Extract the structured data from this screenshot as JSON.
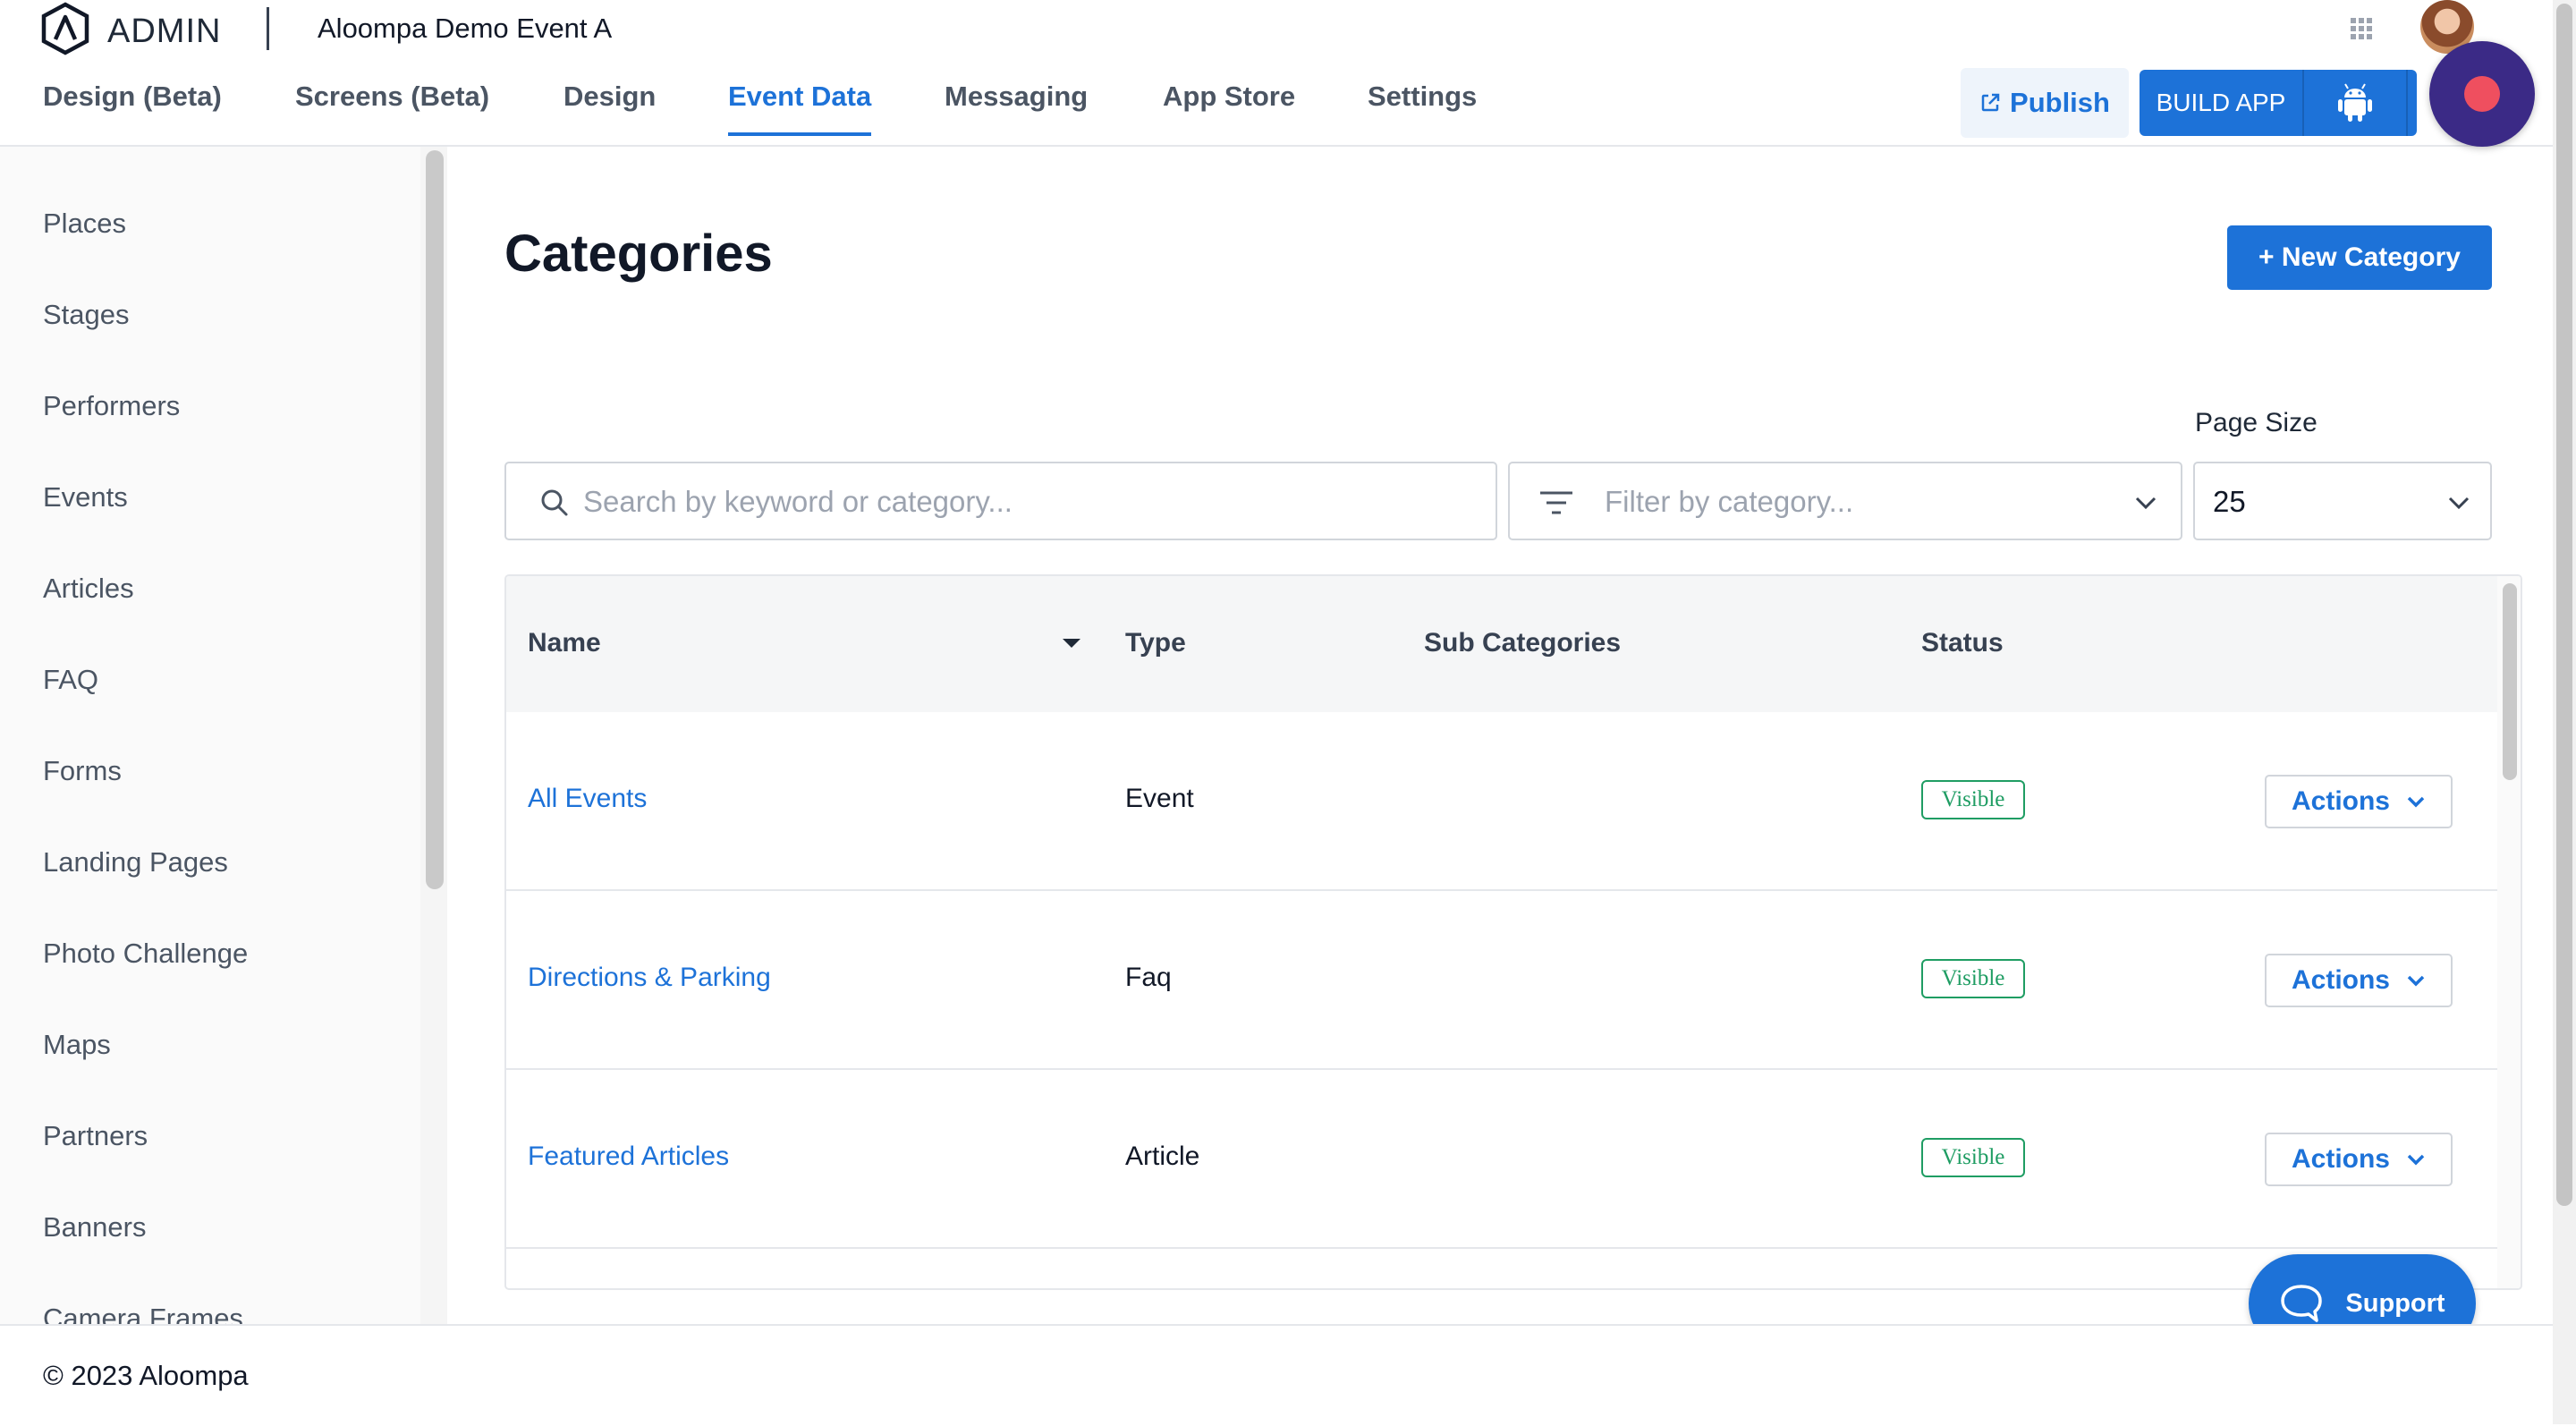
{
  "header": {
    "logo_text": "ADMIN",
    "event_title": "Aloompa Demo Event A"
  },
  "nav": {
    "tabs": [
      {
        "label": "Design (Beta)"
      },
      {
        "label": "Screens (Beta)"
      },
      {
        "label": "Design"
      },
      {
        "label": "Event Data",
        "active": true
      },
      {
        "label": "Messaging"
      },
      {
        "label": "App Store"
      },
      {
        "label": "Settings"
      }
    ],
    "publish_label": "Publish",
    "build_label": "BUILD APP"
  },
  "sidebar": {
    "items": [
      {
        "label": "Places"
      },
      {
        "label": "Stages"
      },
      {
        "label": "Performers"
      },
      {
        "label": "Events"
      },
      {
        "label": "Articles"
      },
      {
        "label": "FAQ"
      },
      {
        "label": "Forms"
      },
      {
        "label": "Landing Pages"
      },
      {
        "label": "Photo Challenge"
      },
      {
        "label": "Maps"
      },
      {
        "label": "Partners"
      },
      {
        "label": "Banners"
      },
      {
        "label": "Camera Frames"
      }
    ]
  },
  "main": {
    "title": "Categories",
    "new_button": "+ New Category",
    "search": {
      "placeholder": "Search by keyword or category...",
      "value": ""
    },
    "filter": {
      "placeholder": "Filter by category..."
    },
    "page_size": {
      "label": "Page Size",
      "value": "25"
    }
  },
  "table": {
    "headers": {
      "name": "Name",
      "type": "Type",
      "sub": "Sub Categories",
      "status": "Status"
    },
    "rows": [
      {
        "name": "All Events",
        "type": "Event",
        "status": "Visible",
        "action": "Actions"
      },
      {
        "name": "Directions & Parking",
        "type": "Faq",
        "status": "Visible",
        "action": "Actions"
      },
      {
        "name": "Featured Articles",
        "type": "Article",
        "status": "Visible",
        "action": "Actions"
      }
    ]
  },
  "support_label": "Support",
  "footer_text": "© 2023 Aloompa",
  "colors": {
    "accent": "#1d72d8",
    "visible_badge": "#1f9d63",
    "record_button": "#3b2a86"
  }
}
